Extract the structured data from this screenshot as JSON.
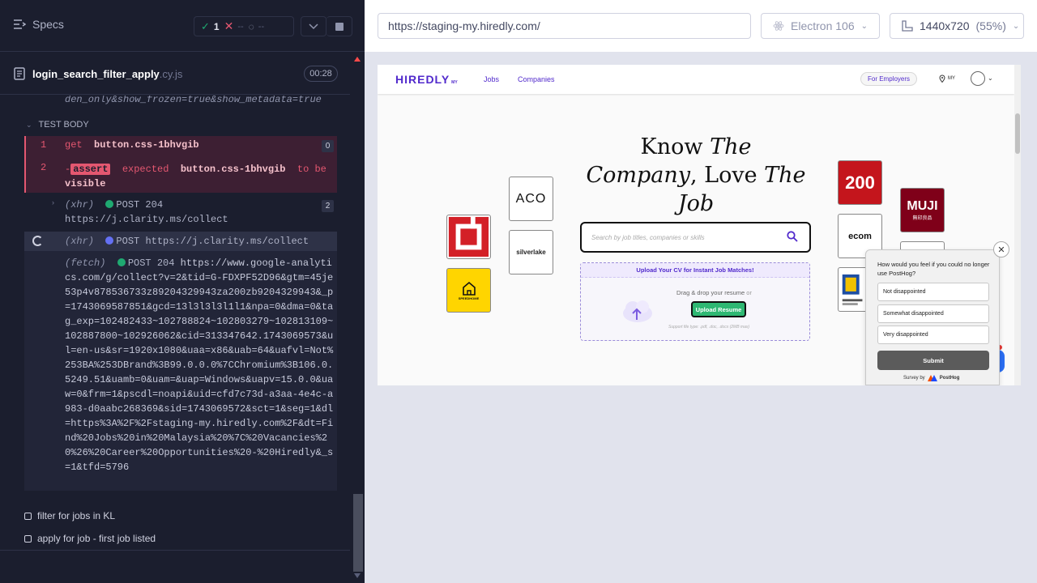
{
  "reporter": {
    "specs_label": "Specs",
    "stats": {
      "passed": "1",
      "failed": "--",
      "pending": "--"
    },
    "file": {
      "name": "login_search_filter_apply",
      "ext": ".cy.js",
      "duration": "00:28"
    },
    "url_fragment": "den_only&show_frozen=true&show_metadata=true",
    "section_title": "TEST BODY",
    "commands": [
      {
        "num": "1",
        "name": "get",
        "selector": "button.css-1bhvgib",
        "count": "0"
      },
      {
        "num": "2",
        "prefix": "-",
        "badge": "assert",
        "msg_pre": "expected",
        "selector": "button.css-1bhvgib",
        "msg_mid": "to be",
        "msg_post": "visible"
      }
    ],
    "xhr1": {
      "type": "(xhr)",
      "status": "POST 204",
      "url": "https://j.clarity.ms/collect",
      "count": "2"
    },
    "xhr2": {
      "type": "(xhr)",
      "status": "POST",
      "url": "https://j.clarity.ms/collect"
    },
    "fetch": {
      "type": "(fetch)",
      "status": "POST 204",
      "url": "https://www.google-analytics.com/g/collect?v=2&tid=G-FDXPF52D96&gtm=45je53p4v878536733z89204329943za200zb9204329943&_p=1743069587851&gcd=13l3l3l3l1l1&npa=0&dma=0&tag_exp=102482433~102788824~102803279~102813109~102887800~102926062&cid=313347642.1743069573&ul=en-us&sr=1920x1080&uaa=x86&uab=64&uafvl=Not%253BA%253DBrand%3B99.0.0.0%7CChromium%3B106.0.5249.51&uamb=0&uam=&uap=Windows&uapv=15.0.0&uaw=0&frm=1&pscdl=noapi&uid=cfd7c73d-a3aa-4e4c-a983-d0aabc268369&sid=1743069572&sct=1&seg=1&dl=https%3A%2F%2Fstaging-my.hiredly.com%2F&dt=Find%20Jobs%20in%20Malaysia%20%7C%20Vacancies%20%26%20Career%20Opportunities%20-%20Hiredly&_s=1&tfd=5796"
    },
    "tests": [
      "filter for jobs in KL",
      "apply for job - first job listed"
    ]
  },
  "aut": {
    "url": "https://staging-my.hiredly.com/",
    "browser": "Electron 106",
    "viewport": "1440x720",
    "scale": "(55%)"
  },
  "site": {
    "logo": "HIREDLY",
    "logo_sub": "MY",
    "nav_jobs": "Jobs",
    "nav_companies": "Companies",
    "for_employers": "For Employers",
    "region": "MY",
    "hero_line1": "Know ",
    "hero_line1_it": "The",
    "hero_line2_it": "Company",
    "hero_line2": ", Love ",
    "hero_line2_it2": "The",
    "hero_line3_it": "Job",
    "search_placeholder": "Search by job titles, companies or skills",
    "upload_header": "Upload Your CV for Instant Job Matches!",
    "upload_drag": "Drag & drop your resume",
    "upload_or": "or",
    "upload_button": "Upload Resume",
    "upload_support": "Support file type: .pdf, .doc, .docx (2MB max)",
    "logos": {
      "aco": "ACO",
      "silverlake": "silverlake",
      "speedhome": "SPEEDHOME",
      "two_hundred": "200",
      "muji": "MUJI",
      "muji_sub": "無印良品",
      "ecom": "ecom"
    }
  },
  "survey": {
    "question": "How would you feel if you could no longer use PostHog?",
    "options": [
      "Not disappointed",
      "Somewhat disappointed",
      "Very disappointed"
    ],
    "submit": "Submit",
    "footer_pre": "Survey by",
    "footer_brand": "PostHog"
  }
}
